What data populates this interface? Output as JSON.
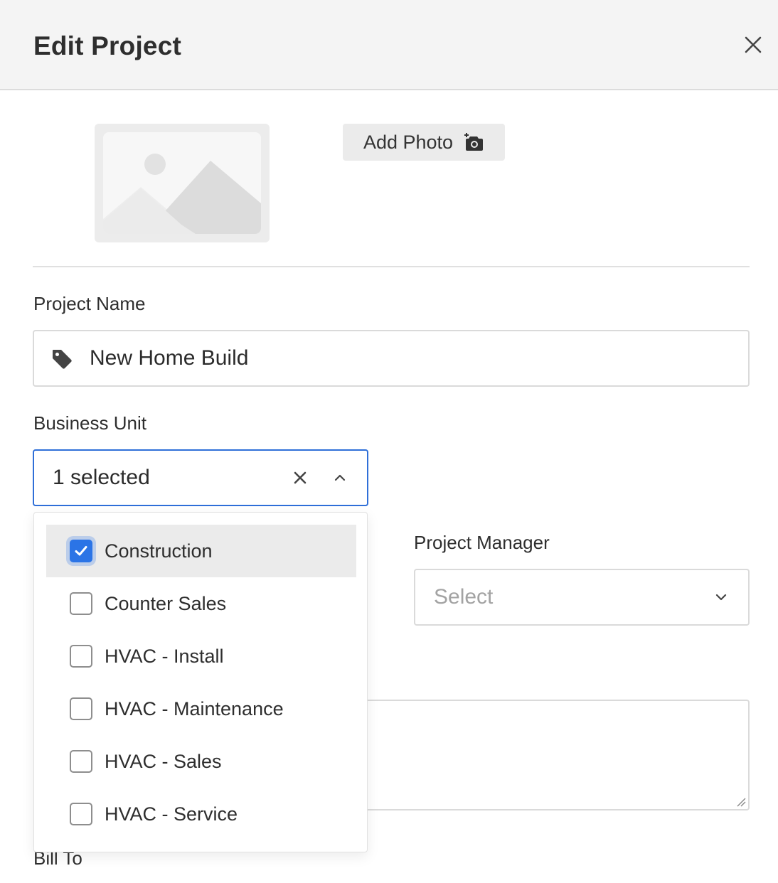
{
  "modal": {
    "title": "Edit Project",
    "close_icon": "close-icon"
  },
  "photo": {
    "placeholder_icon": "image-placeholder-icon",
    "add_photo_label": "Add Photo",
    "add_photo_icon": "camera-add-icon"
  },
  "project_name": {
    "label": "Project Name",
    "value": "New Home Build",
    "icon": "tag-icon"
  },
  "business_unit": {
    "label": "Business Unit",
    "value": "1 selected",
    "clear_icon": "clear-icon",
    "toggle_icon": "chevron-up-icon",
    "options": [
      {
        "label": "Construction",
        "checked": true
      },
      {
        "label": "Counter Sales",
        "checked": false
      },
      {
        "label": "HVAC - Install",
        "checked": false
      },
      {
        "label": "HVAC - Maintenance",
        "checked": false
      },
      {
        "label": "HVAC - Sales",
        "checked": false
      },
      {
        "label": "HVAC - Service",
        "checked": false
      }
    ]
  },
  "project_manager": {
    "label": "Project Manager",
    "placeholder": "Select",
    "icon": "chevron-down-icon"
  },
  "bill_to": {
    "label": "Bill To"
  },
  "colors": {
    "accent": "#2b74e6",
    "focus_border": "#2f6fd8",
    "header_bg": "#f4f4f4"
  }
}
